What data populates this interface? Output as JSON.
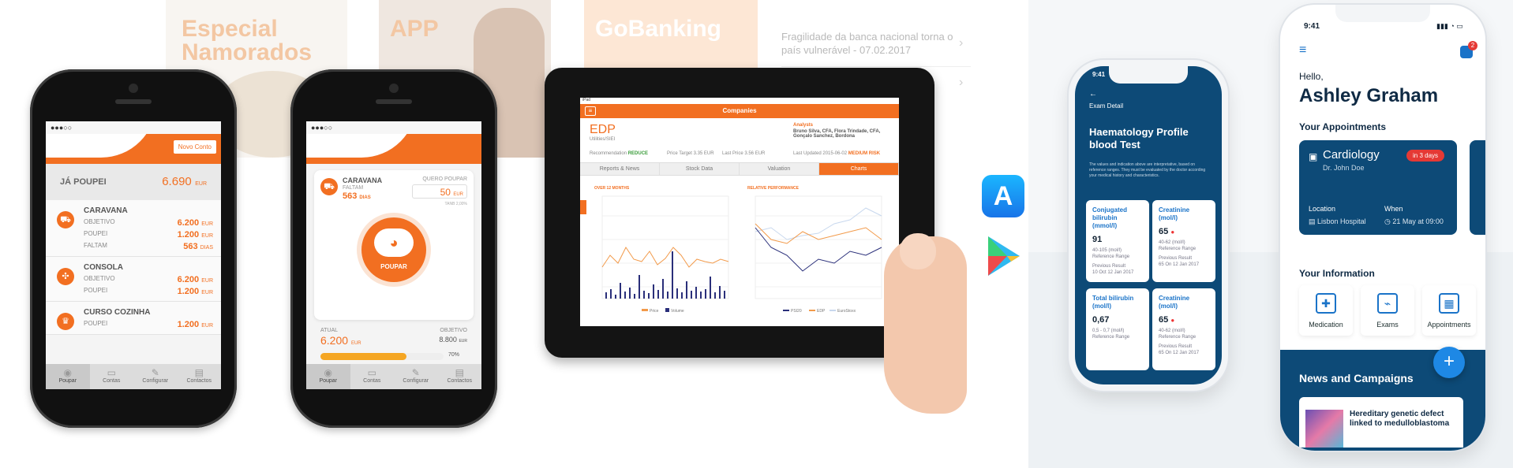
{
  "promos": {
    "banner1": [
      "Especial",
      "Namorados"
    ],
    "banner2": "APP",
    "banner3": "GoBanking",
    "news": [
      "Fragilidade da banca nacional torna o",
      "país vulnerável - 07.02.2017"
    ]
  },
  "phone1": {
    "header_button": "Novo Conto",
    "summary_label": "JÁ POUPEI",
    "summary_value": "6.690",
    "summary_unit": "EUR",
    "items": [
      {
        "title": "CARAVANA",
        "rows": [
          {
            "k": "OBJETIVO",
            "v": "6.200",
            "u": "EUR"
          },
          {
            "k": "POUPEI",
            "v": "1.200",
            "u": "EUR"
          },
          {
            "k": "FALTAM",
            "v": "563",
            "u": "DIAS"
          }
        ]
      },
      {
        "title": "CONSOLA",
        "rows": [
          {
            "k": "OBJETIVO",
            "v": "6.200",
            "u": "EUR"
          },
          {
            "k": "POUPEI",
            "v": "1.200",
            "u": "EUR"
          }
        ]
      },
      {
        "title": "CURSO COZINHA",
        "rows": [
          {
            "k": "POUPEI",
            "v": "1.200",
            "u": "EUR"
          }
        ]
      }
    ],
    "tabs": [
      "Poupar",
      "Contas",
      "Configurar",
      "Contactos"
    ]
  },
  "phone2": {
    "goal_name": "CARAVANA",
    "goal_sub": "FALTAM",
    "goal_days": "563",
    "goal_days_unit": "DIAS",
    "want_label": "QUERO POUPAR",
    "want_value": "50",
    "want_unit": "EUR",
    "rate": "TANB 2,00%",
    "piggy_label": "POUPAR",
    "current_label": "ATUAL",
    "current_value": "6.200",
    "current_unit": "EUR",
    "target_label": "OBJETIVO",
    "target_value": "8.800",
    "target_unit": "EUR",
    "progress": 0.7,
    "progress_text": "70%",
    "tabs": [
      "Poupar",
      "Contas",
      "Configurar",
      "Contactos"
    ]
  },
  "tablet": {
    "status_left": "iPad",
    "title": "Companies",
    "company": "EDP",
    "company_sub": "Utilities/SIEI",
    "recommendation_label": "Recommendation",
    "recommendation": "REDUCE",
    "price_target": "Price Target 3.35 EUR",
    "last_price": "Last Price 3.56 EUR",
    "analysts_label": "Analysts",
    "analysts": "Bruno Silva, CFA, Flora Trindade, CFA, Gonçalo Sanchez, Bordona",
    "updated": "Last Updated 2015-06-02",
    "risk": "MEDIUM RISK",
    "tabs": [
      "Reports & News",
      "Stock Data",
      "Valuation",
      "Charts"
    ],
    "chart1_title": "OVER 12 MONTHS",
    "chart2_title": "RELATIVE PERFORMANCE",
    "chart1_legend": [
      "Price",
      "Volume"
    ],
    "chart2_legend": [
      "PSI20",
      "EDP",
      "EuroStoxx"
    ]
  },
  "medical_left": {
    "time": "9:41",
    "back_label": "Exam Detail",
    "title": "Haematology Profile blood Test",
    "description": "The values and indication above are interpretative, based on reference ranges. They must be evaluated by the doctor according your medical history and characteristics.",
    "cards": [
      {
        "label": "Conjugated bilirubin (mmol/l)",
        "value": "91",
        "range": "40-105 (mol/l)",
        "range_label": "Reference Range",
        "prev": "Previous Result",
        "prev_date": "10 Oct 12 Jan 2017"
      },
      {
        "label": "Creatinine (mol/l)",
        "value": "65",
        "range": "40-62 (mol/l)",
        "range_label": "Reference Range",
        "prev": "Previous Result",
        "prev_date": "65 On 12 Jan 2017"
      },
      {
        "label": "Total bilirubin (mol/l)",
        "value": "0,67",
        "range": "0,5 - 0,7 (mol/l)",
        "range_label": "Reference Range",
        "prev": "",
        "prev_date": ""
      },
      {
        "label": "Creatinine (mol/l)",
        "value": "65",
        "range": "40-62 (mol/l)",
        "range_label": "Reference Range",
        "prev": "Previous Result",
        "prev_date": "65 On 12 Jan 2017"
      }
    ]
  },
  "medical_right": {
    "time": "9:41",
    "notif_count": "2",
    "hello": "Hello,",
    "user": "Ashley Graham",
    "appointments_title": "Your Appointments",
    "appointment": {
      "specialty": "Cardiology",
      "doctor": "Dr. John Doe",
      "badge": "in 3 days",
      "location_label": "Location",
      "location": "Lisbon Hospital",
      "when_label": "When",
      "when": "21 May at 09:00"
    },
    "info_title": "Your Information",
    "tiles": [
      "Medication",
      "Exams",
      "Appointments"
    ],
    "news_title": "News and Campaigns",
    "news_item": "Hereditary genetic defect linked to medulloblastoma"
  }
}
